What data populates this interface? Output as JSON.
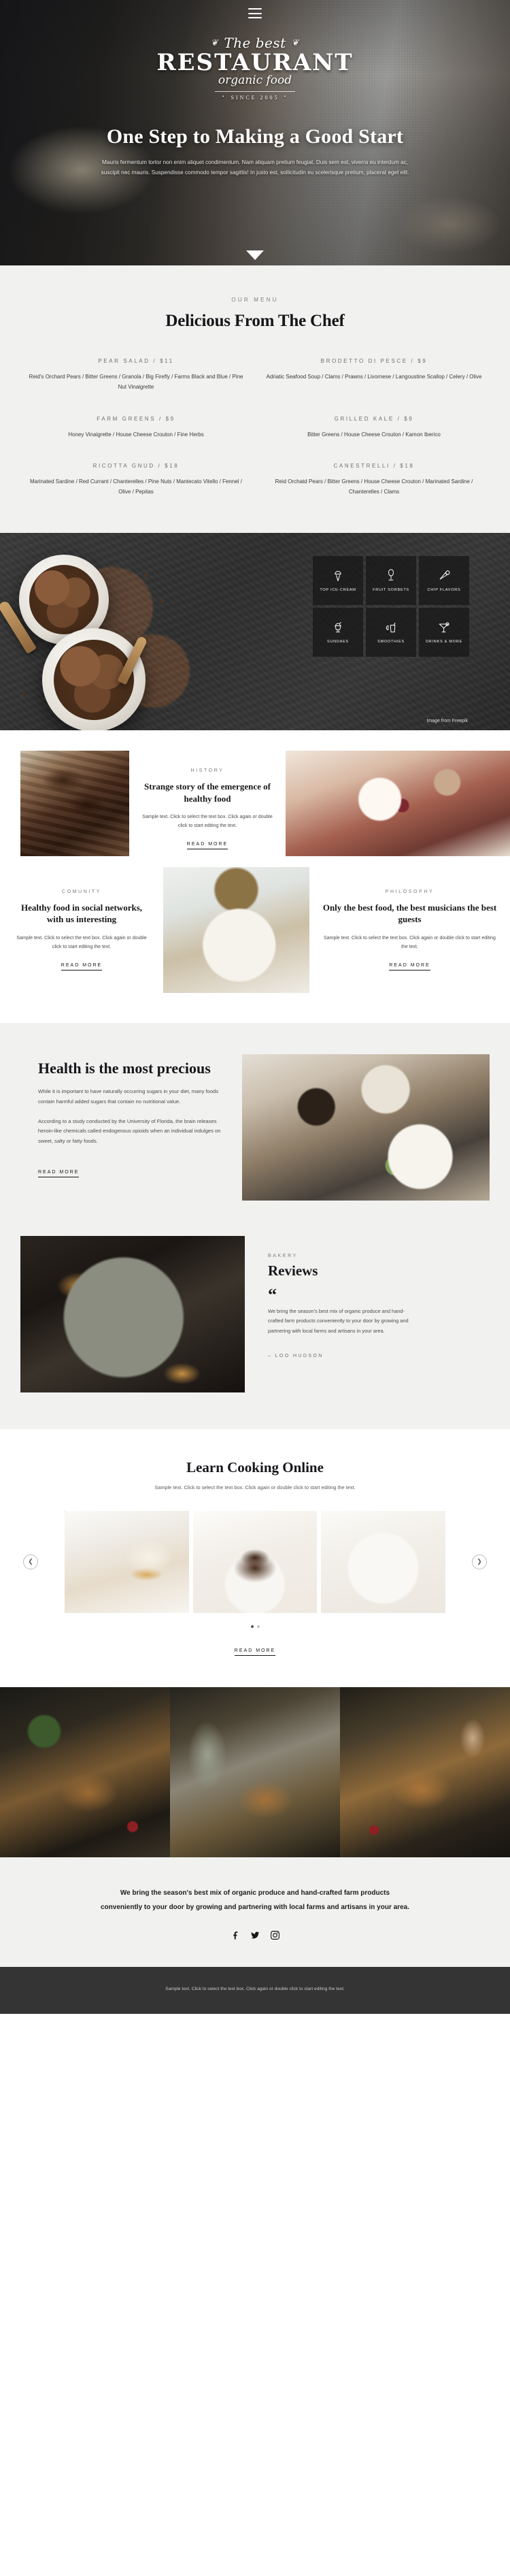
{
  "hero": {
    "menu_icon": "hamburger-icon",
    "logo": {
      "script": "The best",
      "main": "RESTAURANT",
      "sub": "organic food",
      "since": "SINCE 2005"
    },
    "title": "One Step to Making a Good Start",
    "subtitle": "Mauris fermentum tortor non enim aliquet condimentum. Nam aliquam pretium feugiat. Duis sem est, viverra eu interdum ac, suscipit nec mauris. Suspendisse commodo tempor sagittis! In justo est, sollicitudin eu scelerisque pretium, placerat eget elit.",
    "scroll_arrow": "down-arrow-icon"
  },
  "menu_section": {
    "eyebrow": "OUR MENU",
    "title": "Delicious From The Chef",
    "items": [
      {
        "name": "PEAR SALAD / $11",
        "desc": "Reid's Orchard Pears / Bitter Greens / Granola / Big Firefly / Farms Black and Blue / Pine Nut Vinaigrette"
      },
      {
        "name": "BRODETTO DI PESCE / $9",
        "desc": "Adriatic Seafood Soup / Clams / Prawns / Livornese / Langoustine Scallop / Celery / Olive"
      },
      {
        "name": "FARM GREENS / $9",
        "desc": "Honey Vinaigrette / House Cheese Crouton / Fine Herbs"
      },
      {
        "name": "GRILLED KALE / $9",
        "desc": "Bitter Greens / House Cheese Crouton / Kamon Iberico"
      },
      {
        "name": "RICOTTA GNUD / $18",
        "desc": "Marinated Sardine / Red Currant / Chanterelles / Pine Nuts / Mantecato Vitello / Fennel / Olive / Pepitas"
      },
      {
        "name": "CANESTRELLI / $18",
        "desc": "Reid Orchatd Pears / Bitter Greens / House Cheese Crouton / Marinated Sardine / Chanterelles / Clams"
      }
    ]
  },
  "icecream_section": {
    "credit": "Image from Freepik",
    "tiles": [
      {
        "icon": "ice-cream-cone-icon",
        "label": "TOP ICE-CREAM"
      },
      {
        "icon": "sorbet-glass-icon",
        "label": "FRUIT SORBETS"
      },
      {
        "icon": "tilted-cone-icon",
        "label": "CHIP FLAVORS"
      },
      {
        "icon": "sundae-cup-icon",
        "label": "SUNDAES"
      },
      {
        "icon": "smoothie-glass-icon",
        "label": "SMOOTHIES"
      },
      {
        "icon": "cocktail-glass-icon",
        "label": "DRINKS & MORE"
      }
    ]
  },
  "blog": {
    "read_more": "READ MORE",
    "cards": [
      {
        "eyebrow": "HISTORY",
        "title": "Strange story of the emergence of healthy food",
        "body": "Sample text. Click to select the text box. Click again or double click to start editing the text."
      },
      {
        "eyebrow": "COMUNITY",
        "title": "Healthy food in social networks, with us interesting",
        "body": "Sample text. Click to select the text box. Click again or double click to start editing the text."
      },
      {
        "eyebrow": "PHILOSOPHY",
        "title": "Only the best food, the best musicians the best guests",
        "body": "Sample text. Click to select the text box. Click again or double click to start editing the text."
      }
    ]
  },
  "health": {
    "title": "Health is the most precious",
    "paragraph1": "While it is important to have naturally occurring sugars in your diet, many foods contain harmful added sugars that contain no nutritional value.",
    "paragraph2": "According to a study conducted by the University of Florida, the brain releases heroin-like chemicals called endogenous opioids when an individual indulges on sweet, salty or fatty foods.",
    "read_more": "READ MORE"
  },
  "reviews": {
    "eyebrow": "BAKERY",
    "title": "Reviews",
    "quote_mark": "“",
    "body": "We bring the season's best mix of organic produce and hand-crafted farm products conveniently to your door by growing and partnering with local farms and artisans in your area.",
    "author": "– LOO HUDSON"
  },
  "learn": {
    "title": "Learn Cooking Online",
    "subtitle": "Sample text. Click to select the text box. Click again or double click to start editing the text.",
    "prev_icon": "chevron-left-icon",
    "next_icon": "chevron-right-icon",
    "read_more": "READ MORE"
  },
  "footer": {
    "cta": "We bring the season's best mix of organic produce and hand-crafted farm products conveniently to your door by growing and partnering with local farms and artisans in your area.",
    "socials": [
      "facebook-icon",
      "twitter-icon",
      "instagram-icon"
    ],
    "note": "Sample text. Click to select the text box. Click again or double click to start editing the text."
  }
}
